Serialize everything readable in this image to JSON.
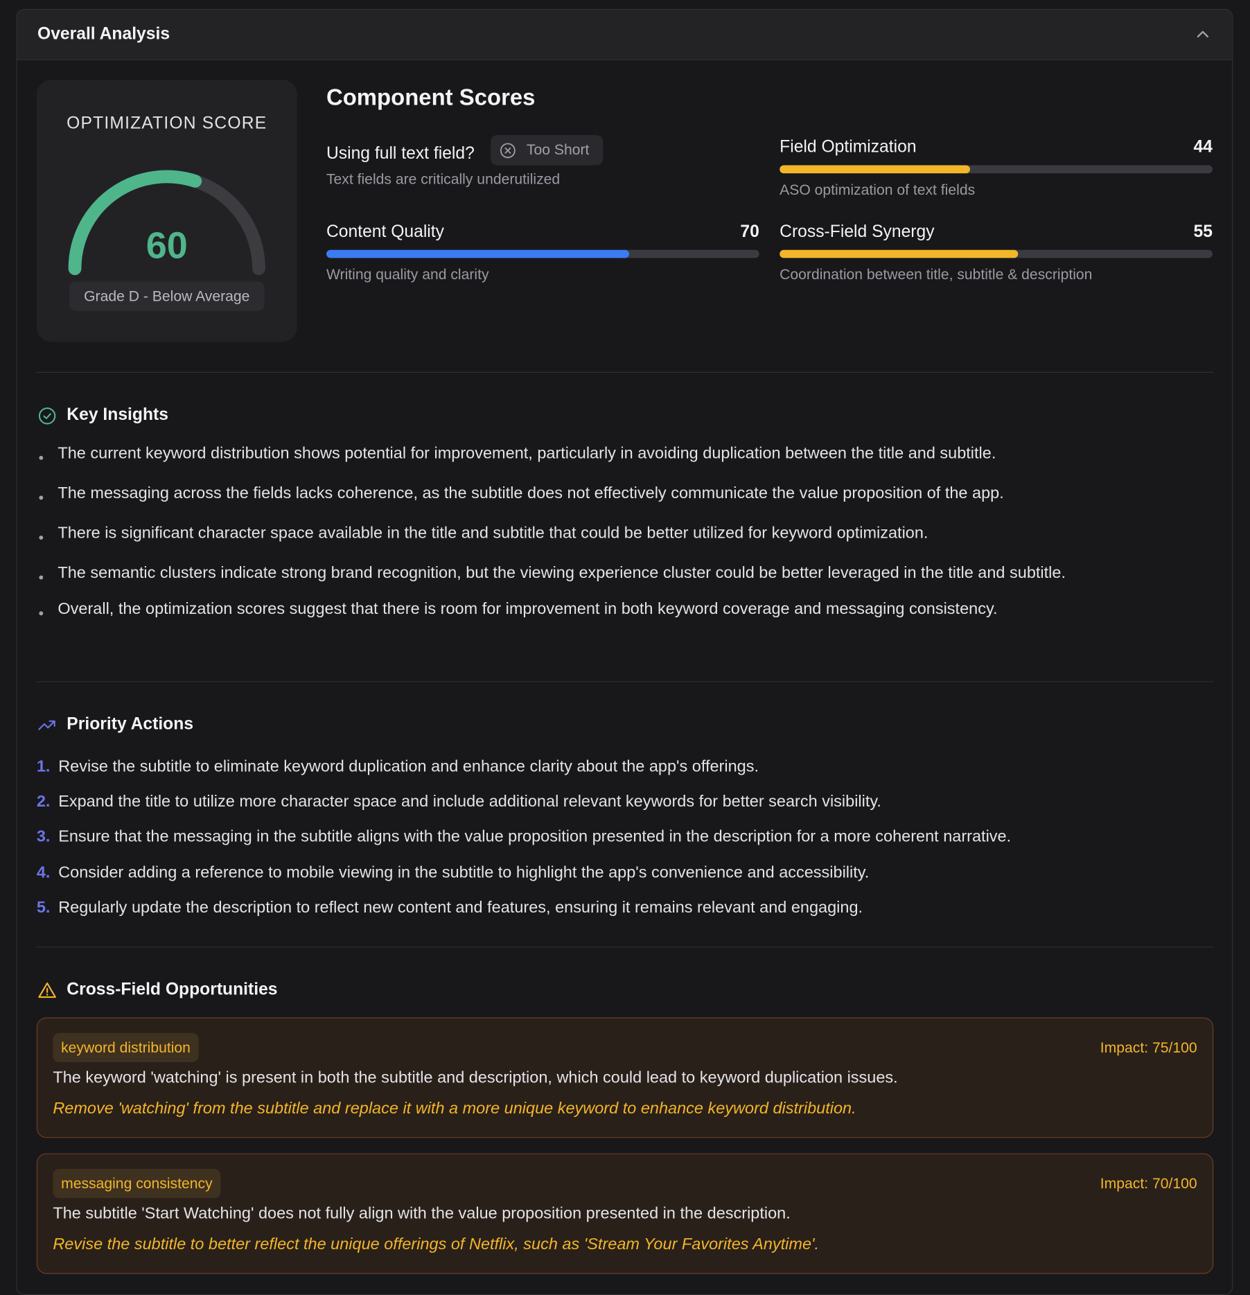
{
  "panel": {
    "title": "Overall Analysis"
  },
  "score": {
    "label": "OPTIMIZATION SCORE",
    "value": "60",
    "percent": 60,
    "grade": "Grade D - Below Average",
    "color": "#4fb58a"
  },
  "components": {
    "title": "Component Scores",
    "full_text_field": {
      "label": "Using full text field?",
      "badge": "Too Short",
      "desc": "Text fields are critically underutilized"
    },
    "metrics": [
      {
        "name": "Field Optimization",
        "value": "44",
        "percent": 44,
        "color": "#f3b62a",
        "desc": "ASO optimization of text fields"
      },
      {
        "name": "Content Quality",
        "value": "70",
        "percent": 70,
        "color": "#3b7cf5",
        "desc": "Writing quality and clarity"
      },
      {
        "name": "Cross-Field Synergy",
        "value": "55",
        "percent": 55,
        "color": "#f3b62a",
        "desc": "Coordination between title, subtitle & description"
      }
    ]
  },
  "key_insights": {
    "title": "Key Insights",
    "items": [
      "The current keyword distribution shows potential for improvement, particularly in avoiding duplication between the title and subtitle.",
      "The messaging across the fields lacks coherence, as the subtitle does not effectively communicate the value proposition of the app.",
      "There is significant character space available in the title and subtitle that could be better utilized for keyword optimization.",
      "The semantic clusters indicate strong brand recognition, but the viewing experience cluster could be better leveraged in the title and subtitle.",
      "Overall, the optimization scores suggest that there is room for improvement in both keyword coverage and messaging consistency."
    ]
  },
  "priority_actions": {
    "title": "Priority Actions",
    "items": [
      {
        "num": "1.",
        "text": "Revise the subtitle to eliminate keyword duplication and enhance clarity about the app's offerings."
      },
      {
        "num": "2.",
        "text": "Expand the title to utilize more character space and include additional relevant keywords for better search visibility."
      },
      {
        "num": "3.",
        "text": "Ensure that the messaging in the subtitle aligns with the value proposition presented in the description for a more coherent narrative."
      },
      {
        "num": "4.",
        "text": "Consider adding a reference to mobile viewing in the subtitle to highlight the app's convenience and accessibility."
      },
      {
        "num": "5.",
        "text": "Regularly update the description to reflect new content and features, ensuring it remains relevant and engaging."
      }
    ]
  },
  "opportunities": {
    "title": "Cross-Field Opportunities",
    "items": [
      {
        "tag": "keyword distribution",
        "impact": "Impact: 75/100",
        "issue": "The keyword 'watching' is present in both the subtitle and description, which could lead to keyword duplication issues.",
        "fix": "Remove 'watching' from the subtitle and replace it with a more unique keyword to enhance keyword distribution."
      },
      {
        "tag": "messaging consistency",
        "impact": "Impact: 70/100",
        "issue": "The subtitle 'Start Watching' does not fully align with the value proposition presented in the description.",
        "fix": "Revise the subtitle to better reflect the unique offerings of Netflix, such as 'Stream Your Favorites Anytime'."
      }
    ]
  }
}
